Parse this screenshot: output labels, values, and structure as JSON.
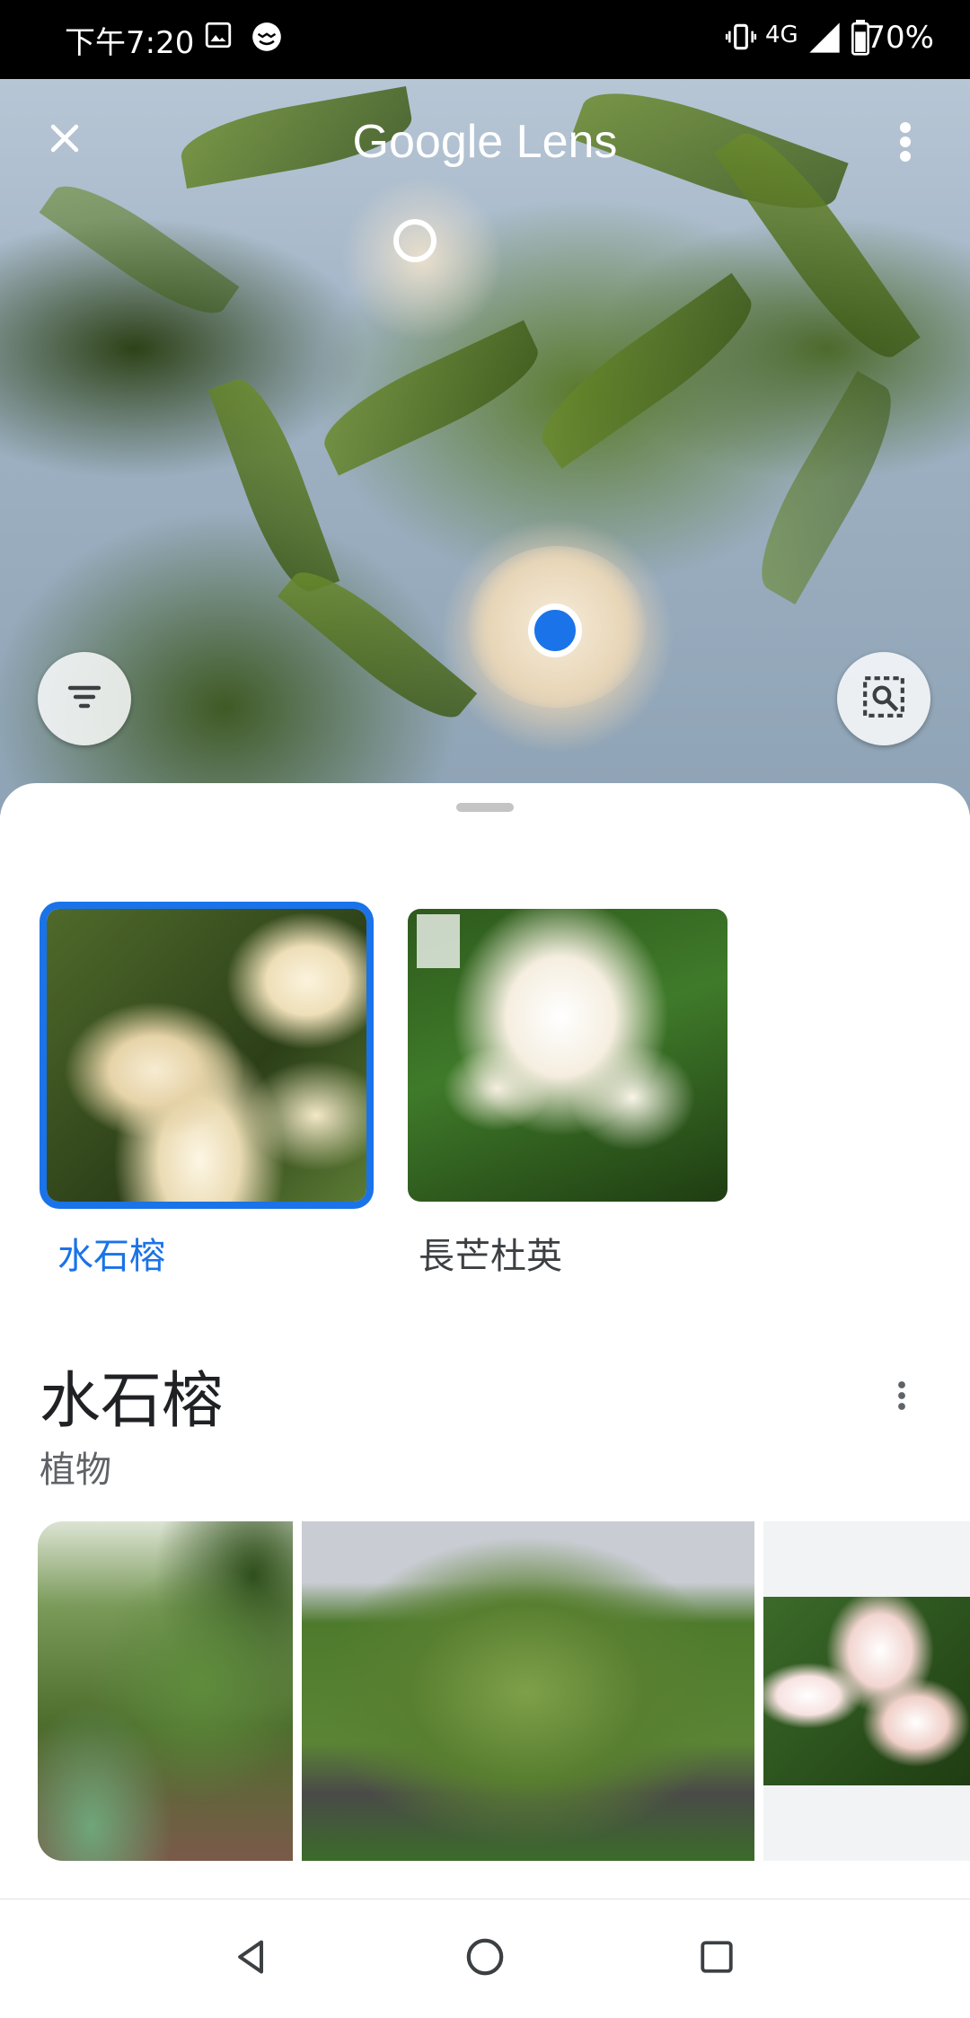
{
  "status_bar": {
    "time": "下午7:20",
    "network": "4G",
    "battery": "70%"
  },
  "header": {
    "title": "Google Lens",
    "close_icon": "close-icon",
    "more_icon": "more-vert-icon"
  },
  "camera_controls": {
    "filter_icon": "filter-icon",
    "search_region_icon": "image-search-icon"
  },
  "results": [
    {
      "label": "水石榕",
      "selected": true
    },
    {
      "label": "長芒杜英",
      "selected": false
    }
  ],
  "entity": {
    "title": "水石榕",
    "subtitle": "植物",
    "more_icon": "more-vert-icon"
  },
  "nav": {
    "back_icon": "back-icon",
    "home_icon": "home-icon",
    "recents_icon": "recents-icon"
  },
  "colors": {
    "accent": "#1a73e8",
    "text_primary": "#202124",
    "text_secondary": "#5f6368"
  }
}
